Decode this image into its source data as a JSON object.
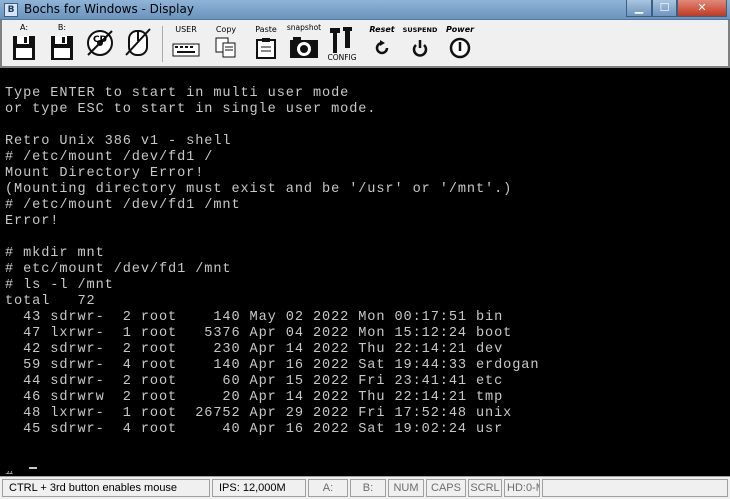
{
  "window": {
    "title": "Bochs for Windows - Display",
    "app_icon": "B",
    "controls": {
      "minimize": "▁",
      "maximize": "☐",
      "close": "✕"
    }
  },
  "toolbar": {
    "floppy_a": "A:",
    "floppy_b": "B:",
    "cdrom": "CD",
    "mouse": "",
    "user": "USER",
    "copy": "Copy",
    "paste": "Paste",
    "snapshot": "snapshot",
    "config": "CONFIG",
    "reset": "Reset",
    "suspend": "SUSPEND",
    "power": "Power"
  },
  "console": {
    "lines": [
      "Type ENTER to start in multi user mode",
      "or type ESC to start in single user mode.",
      "",
      "Retro Unix 386 v1 - shell",
      "# /etc/mount /dev/fd1 /",
      "Mount Directory Error!",
      "(Mounting directory must exist and be '/usr' or '/mnt'.)",
      "# /etc/mount /dev/fd1 /mnt",
      "Error!",
      "",
      "# mkdir mnt",
      "# etc/mount /dev/fd1 /mnt",
      "# ls -l /mnt",
      "total   72",
      "  43 sdrwr-  2 root    140 May 02 2022 Mon 00:17:51 bin",
      "  47 lxrwr-  1 root   5376 Apr 04 2022 Mon 15:12:24 boot",
      "  42 sdrwr-  2 root    230 Apr 14 2022 Thu 22:14:21 dev",
      "  59 sdrwr-  4 root    140 Apr 16 2022 Sat 19:44:33 erdogan",
      "  44 sdrwr-  2 root     60 Apr 15 2022 Fri 23:41:41 etc",
      "  46 sdrwrw  2 root     20 Apr 14 2022 Thu 22:14:21 tmp",
      "  48 lxrwr-  1 root  26752 Apr 29 2022 Fri 17:52:48 unix",
      "  45 sdrwr-  4 root     40 Apr 16 2022 Sat 19:02:24 usr",
      "",
      "",
      "# _"
    ]
  },
  "statusbar": {
    "mouse_hint": "CTRL + 3rd button enables mouse",
    "ips": "IPS: 12,000M",
    "a": "A:",
    "b": "B:",
    "num": "NUM",
    "caps": "CAPS",
    "scrl": "SCRL",
    "hd": "HD:0-M"
  },
  "colors": {
    "console_bg": "#000000",
    "console_fg": "#c8c8c8",
    "titlebar": "#7aa1c9",
    "close_button": "#c2391f"
  }
}
